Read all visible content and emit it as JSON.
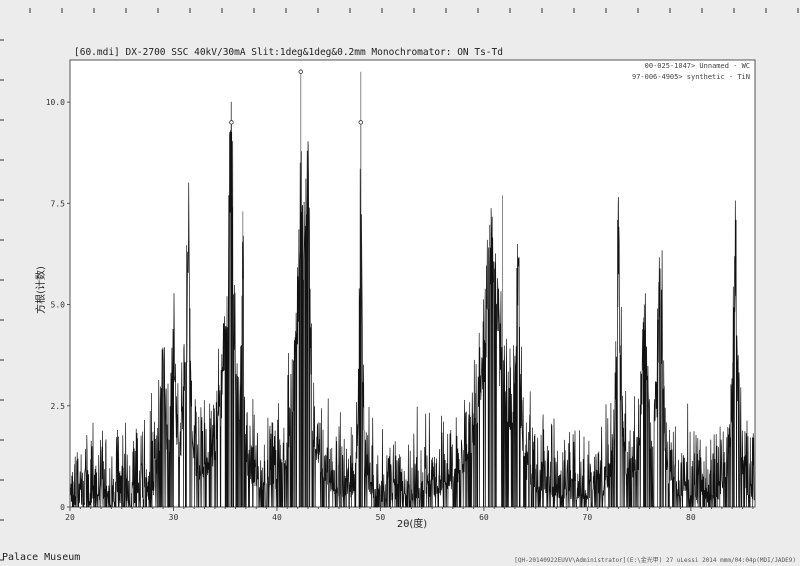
{
  "window": {
    "title": "[60.mdi] DX-2700 SSC 40kV/30mA Slit:1deg&1deg&0.2mm Monochromator: ON Ts-Td",
    "footer_left": "Palace Museum",
    "footer_right": "[QH-20140922EUVV\\Administrator](E:\\金光甲) 27 uLessi 2014 mmm/04:04p(MDI/JADE9)"
  },
  "chart_data": {
    "type": "line",
    "title": "[60.mdi] DX-2700 SSC 40kV/30mA Slit:1deg&1deg&0.2mm Monochromator: ON Ts-Td",
    "xlabel": "2θ(度)",
    "ylabel": "方根(计数)",
    "xlim": [
      20,
      86.2
    ],
    "ylim": [
      0,
      11.04
    ],
    "x_ticks": [
      20,
      30,
      40,
      50,
      60,
      70,
      80
    ],
    "y_ticks": [
      {
        "v": 0,
        "label": "0"
      },
      {
        "v": 2.5,
        "label": "2.5"
      },
      {
        "v": 5.0,
        "label": "5.0"
      },
      {
        "v": 7.5,
        "label": "7.5"
      },
      {
        "v": 10.0,
        "label": "10.0"
      }
    ],
    "grid": false,
    "legend_position": "top-right",
    "legend": [
      "00-025-1047> Unnamed - WC",
      "97-006-4905> synthetic - TiN"
    ],
    "baseline_noise_max": 2.0,
    "peaks": [
      {
        "x": 29.0,
        "height": 3.4,
        "width": 0.25
      },
      {
        "x": 30.0,
        "height": 4.2,
        "width": 0.2
      },
      {
        "x": 31.2,
        "height": 4.0,
        "width": 0.3
      },
      {
        "x": 31.5,
        "height": 6.4,
        "width": 0.1
      },
      {
        "x": 35.2,
        "height": 4.2,
        "width": 0.9
      },
      {
        "x": 35.6,
        "height": 9.5,
        "width": 0.15
      },
      {
        "x": 36.7,
        "height": 7.3,
        "width": 0.08
      },
      {
        "x": 42.3,
        "height": 7.6,
        "width": 0.6
      },
      {
        "x": 43.0,
        "height": 6.0,
        "width": 0.2
      },
      {
        "x": 48.1,
        "height": 10.8,
        "width": 0.12
      },
      {
        "x": 60.8,
        "height": 6.8,
        "width": 1.1
      },
      {
        "x": 63.3,
        "height": 6.3,
        "width": 0.2
      },
      {
        "x": 73.0,
        "height": 7.2,
        "width": 0.25
      },
      {
        "x": 75.5,
        "height": 5.5,
        "width": 0.3
      },
      {
        "x": 77.0,
        "height": 6.0,
        "width": 0.3
      },
      {
        "x": 84.3,
        "height": 6.3,
        "width": 0.3
      }
    ],
    "reference_sticks": [
      {
        "x": 35.6,
        "height": 9.5,
        "marker": true
      },
      {
        "x": 36.7,
        "height": 7.3,
        "marker": false
      },
      {
        "x": 42.3,
        "height": 10.75,
        "marker": true
      },
      {
        "x": 48.1,
        "height": 9.5,
        "marker": true
      },
      {
        "x": 48.1,
        "height": 10.75,
        "marker": false
      },
      {
        "x": 61.8,
        "height": 7.7,
        "marker": false
      }
    ],
    "colors": {
      "line": "#111111",
      "stick": "#888888",
      "frame": "#555555"
    }
  }
}
